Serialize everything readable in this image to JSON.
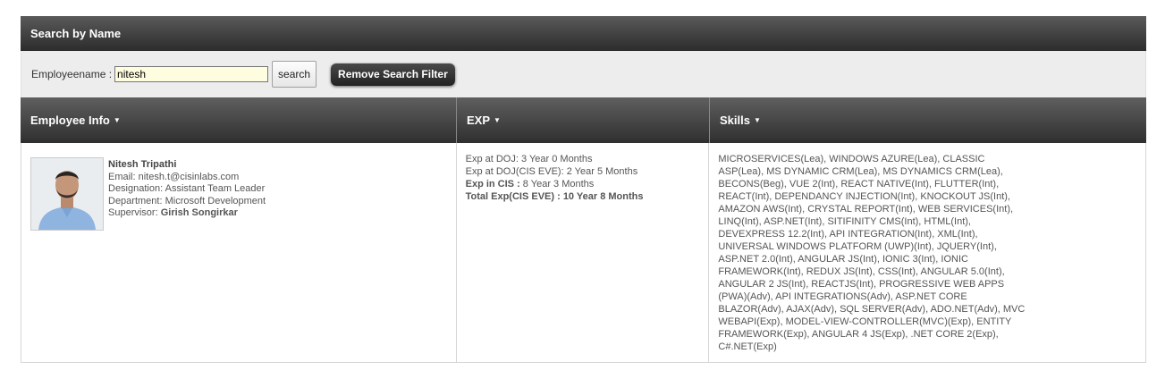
{
  "panel_title": "Search by Name",
  "search": {
    "label": "Employeename :",
    "value": "nitesh",
    "search_button": "search",
    "remove_button": "Remove Search Filter"
  },
  "columns": [
    {
      "label": "Employee Info"
    },
    {
      "label": "EXP"
    },
    {
      "label": "Skills"
    }
  ],
  "employee": {
    "name": "Nitesh Tripathi",
    "email_label": "Email:",
    "email": "nitesh.t@cisinlabs.com",
    "designation_label": "Designation:",
    "designation": "Assistant Team Leader",
    "department_label": "Department:",
    "department": "Microsoft Development",
    "supervisor_label": "Supervisor:",
    "supervisor": "Girish Songirkar"
  },
  "experience": {
    "doj_label": "Exp at DOJ:",
    "doj": "3 Year 0 Months",
    "doj_cis_label": "Exp at DOJ(CIS EVE):",
    "doj_cis": "2 Year 5 Months",
    "in_cis_label": "Exp in CIS :",
    "in_cis": "8 Year 3 Months",
    "total_label": "Total Exp(CIS EVE) :",
    "total": "10 Year 8 Months"
  },
  "skills": "MICROSERVICES(Lea), WINDOWS AZURE(Lea), CLASSIC ASP(Lea), MS DYNAMIC CRM(Lea), MS DYNAMICS CRM(Lea), BECONS(Beg), VUE 2(Int), REACT NATIVE(Int), FLUTTER(Int), REACT(Int), DEPENDANCY INJECTION(Int), KNOCKOUT JS(Int), AMAZON AWS(Int), CRYSTAL REPORT(Int), WEB SERVICES(Int), LINQ(Int), ASP.NET(Int), SITIFINITY CMS(Int), HTML(Int), DEVEXPRESS 12.2(Int), API INTEGRATION(Int), XML(Int), UNIVERSAL WINDOWS PLATFORM (UWP)(Int), JQUERY(Int), ASP.NET 2.0(Int), ANGULAR JS(Int), IONIC 3(Int), IONIC FRAMEWORK(Int), REDUX JS(Int), CSS(Int), ANGULAR 5.0(Int), ANGULAR 2 JS(Int), REACTJS(Int), PROGRESSIVE WEB APPS (PWA)(Adv), API INTEGRATIONS(Adv), ASP.NET CORE BLAZOR(Adv), AJAX(Adv), SQL SERVER(Adv), ADO.NET(Adv), MVC WEBAPI(Exp), MODEL-VIEW-CONTROLLER(MVC)(Exp), ENTITY FRAMEWORK(Exp), ANGULAR 4 JS(Exp), .NET CORE 2(Exp), C#.NET(Exp)"
}
